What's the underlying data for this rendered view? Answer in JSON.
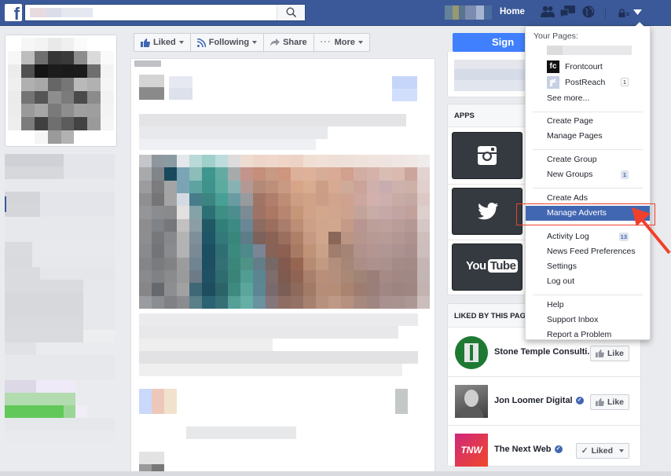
{
  "topbar": {
    "logo": "f",
    "search_placeholder": "",
    "home_label": "Home",
    "icons": [
      "friend-requests-icon",
      "messages-icon",
      "notifications-globe-icon",
      "privacy-shortcuts-icon",
      "account-menu-caret-icon"
    ]
  },
  "page_actions": {
    "liked_label": "Liked",
    "following_label": "Following",
    "share_label": "Share",
    "more_label": "More",
    "signup_label": "Sign Up"
  },
  "apps": {
    "header": "APPS",
    "items": [
      {
        "name": "Instagram",
        "icon": "instagram-icon"
      },
      {
        "name": "Twitter",
        "icon": "twitter-icon"
      },
      {
        "name": "YouTube",
        "icon": "youtube-icon",
        "wordmark_you": "You",
        "wordmark_tube": "Tube"
      }
    ]
  },
  "liked_by_page": {
    "header": "LIKED BY THIS PAGE",
    "items": [
      {
        "name": "Stone Temple Consulti...",
        "verified": false,
        "button": "Like",
        "thumb_color": "#1e7a33"
      },
      {
        "name": "Jon Loomer Digital",
        "verified": true,
        "button": "Like",
        "thumb_color": "#555555"
      },
      {
        "name": "The Next Web",
        "verified": true,
        "button": "Liked",
        "thumb_color": "#e8236b",
        "thumb_text": "TNW"
      }
    ]
  },
  "account_menu": {
    "your_pages_label": "Your Pages:",
    "pages": [
      {
        "name": "",
        "blurred": true
      },
      {
        "name": "Frontcourt",
        "thumb_text": "fc",
        "badge": null
      },
      {
        "name": "PostReach",
        "badge": "1"
      }
    ],
    "see_more": "See more...",
    "sections": [
      [
        {
          "label": "Create Page"
        },
        {
          "label": "Manage Pages"
        }
      ],
      [
        {
          "label": "Create Group"
        },
        {
          "label": "New Groups",
          "badge": "1"
        }
      ],
      [
        {
          "label": "Create Ads"
        },
        {
          "label": "Manage Adverts",
          "active": true
        },
        {
          "label": "Activity Log",
          "badge": "13"
        },
        {
          "label": "News Feed Preferences"
        },
        {
          "label": "Settings"
        },
        {
          "label": "Log out"
        }
      ],
      [
        {
          "label": "Help"
        },
        {
          "label": "Support Inbox"
        },
        {
          "label": "Report a Problem"
        }
      ]
    ]
  },
  "annotation": {
    "highlight_color": "#f0402c",
    "target": "Manage Adverts"
  },
  "colors": {
    "brand": "#3b5998",
    "signup": "#4080ff",
    "menu_active": "#4267b2"
  }
}
